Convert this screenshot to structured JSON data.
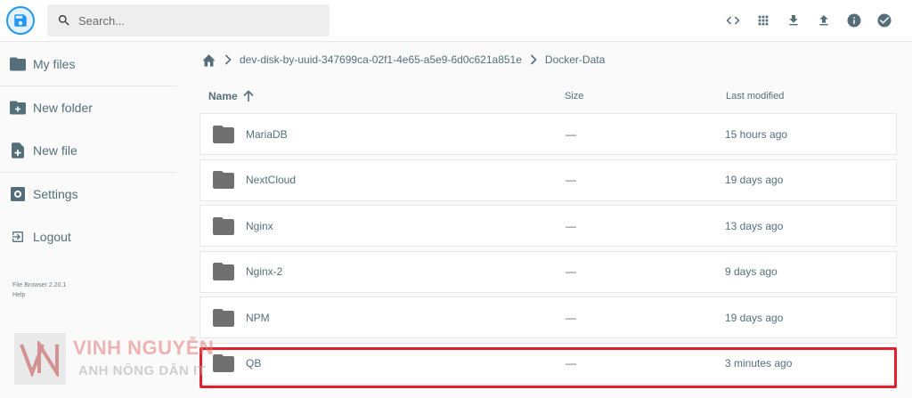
{
  "header": {
    "search_placeholder": "Search...",
    "actions": [
      "code-icon",
      "grid-icon",
      "download-icon",
      "upload-icon",
      "info-icon",
      "check-circle-icon"
    ]
  },
  "sidebar": {
    "items": [
      {
        "label": "My files",
        "icon": "folder-icon"
      },
      {
        "label": "New folder",
        "icon": "new-folder-icon"
      },
      {
        "label": "New file",
        "icon": "new-file-icon"
      },
      {
        "label": "Settings",
        "icon": "settings-icon"
      },
      {
        "label": "Logout",
        "icon": "logout-icon"
      }
    ],
    "version": "File Browser 2.20.1",
    "help": "Help"
  },
  "breadcrumbs": [
    "dev-disk-by-uuid-347699ca-02f1-4e65-a5e9-6d0c621a851e",
    "Docker-Data"
  ],
  "list": {
    "columns": {
      "name": "Name",
      "size": "Size",
      "modified": "Last modified"
    },
    "rows": [
      {
        "name": "MariaDB",
        "size": "—",
        "modified": "15 hours ago"
      },
      {
        "name": "NextCloud",
        "size": "—",
        "modified": "19 days ago"
      },
      {
        "name": "Nginx",
        "size": "—",
        "modified": "13 days ago"
      },
      {
        "name": "Nginx-2",
        "size": "—",
        "modified": "9 days ago"
      },
      {
        "name": "NPM",
        "size": "—",
        "modified": "19 days ago"
      },
      {
        "name": "QB",
        "size": "—",
        "modified": "3 minutes ago"
      }
    ]
  },
  "watermark": {
    "title": "VINH NGUYỄN",
    "subtitle": "ANH NÔNG DÂN IT"
  },
  "colors": {
    "accent": "#2196f3",
    "text": "#546e7a",
    "highlight": "#e0202c"
  }
}
